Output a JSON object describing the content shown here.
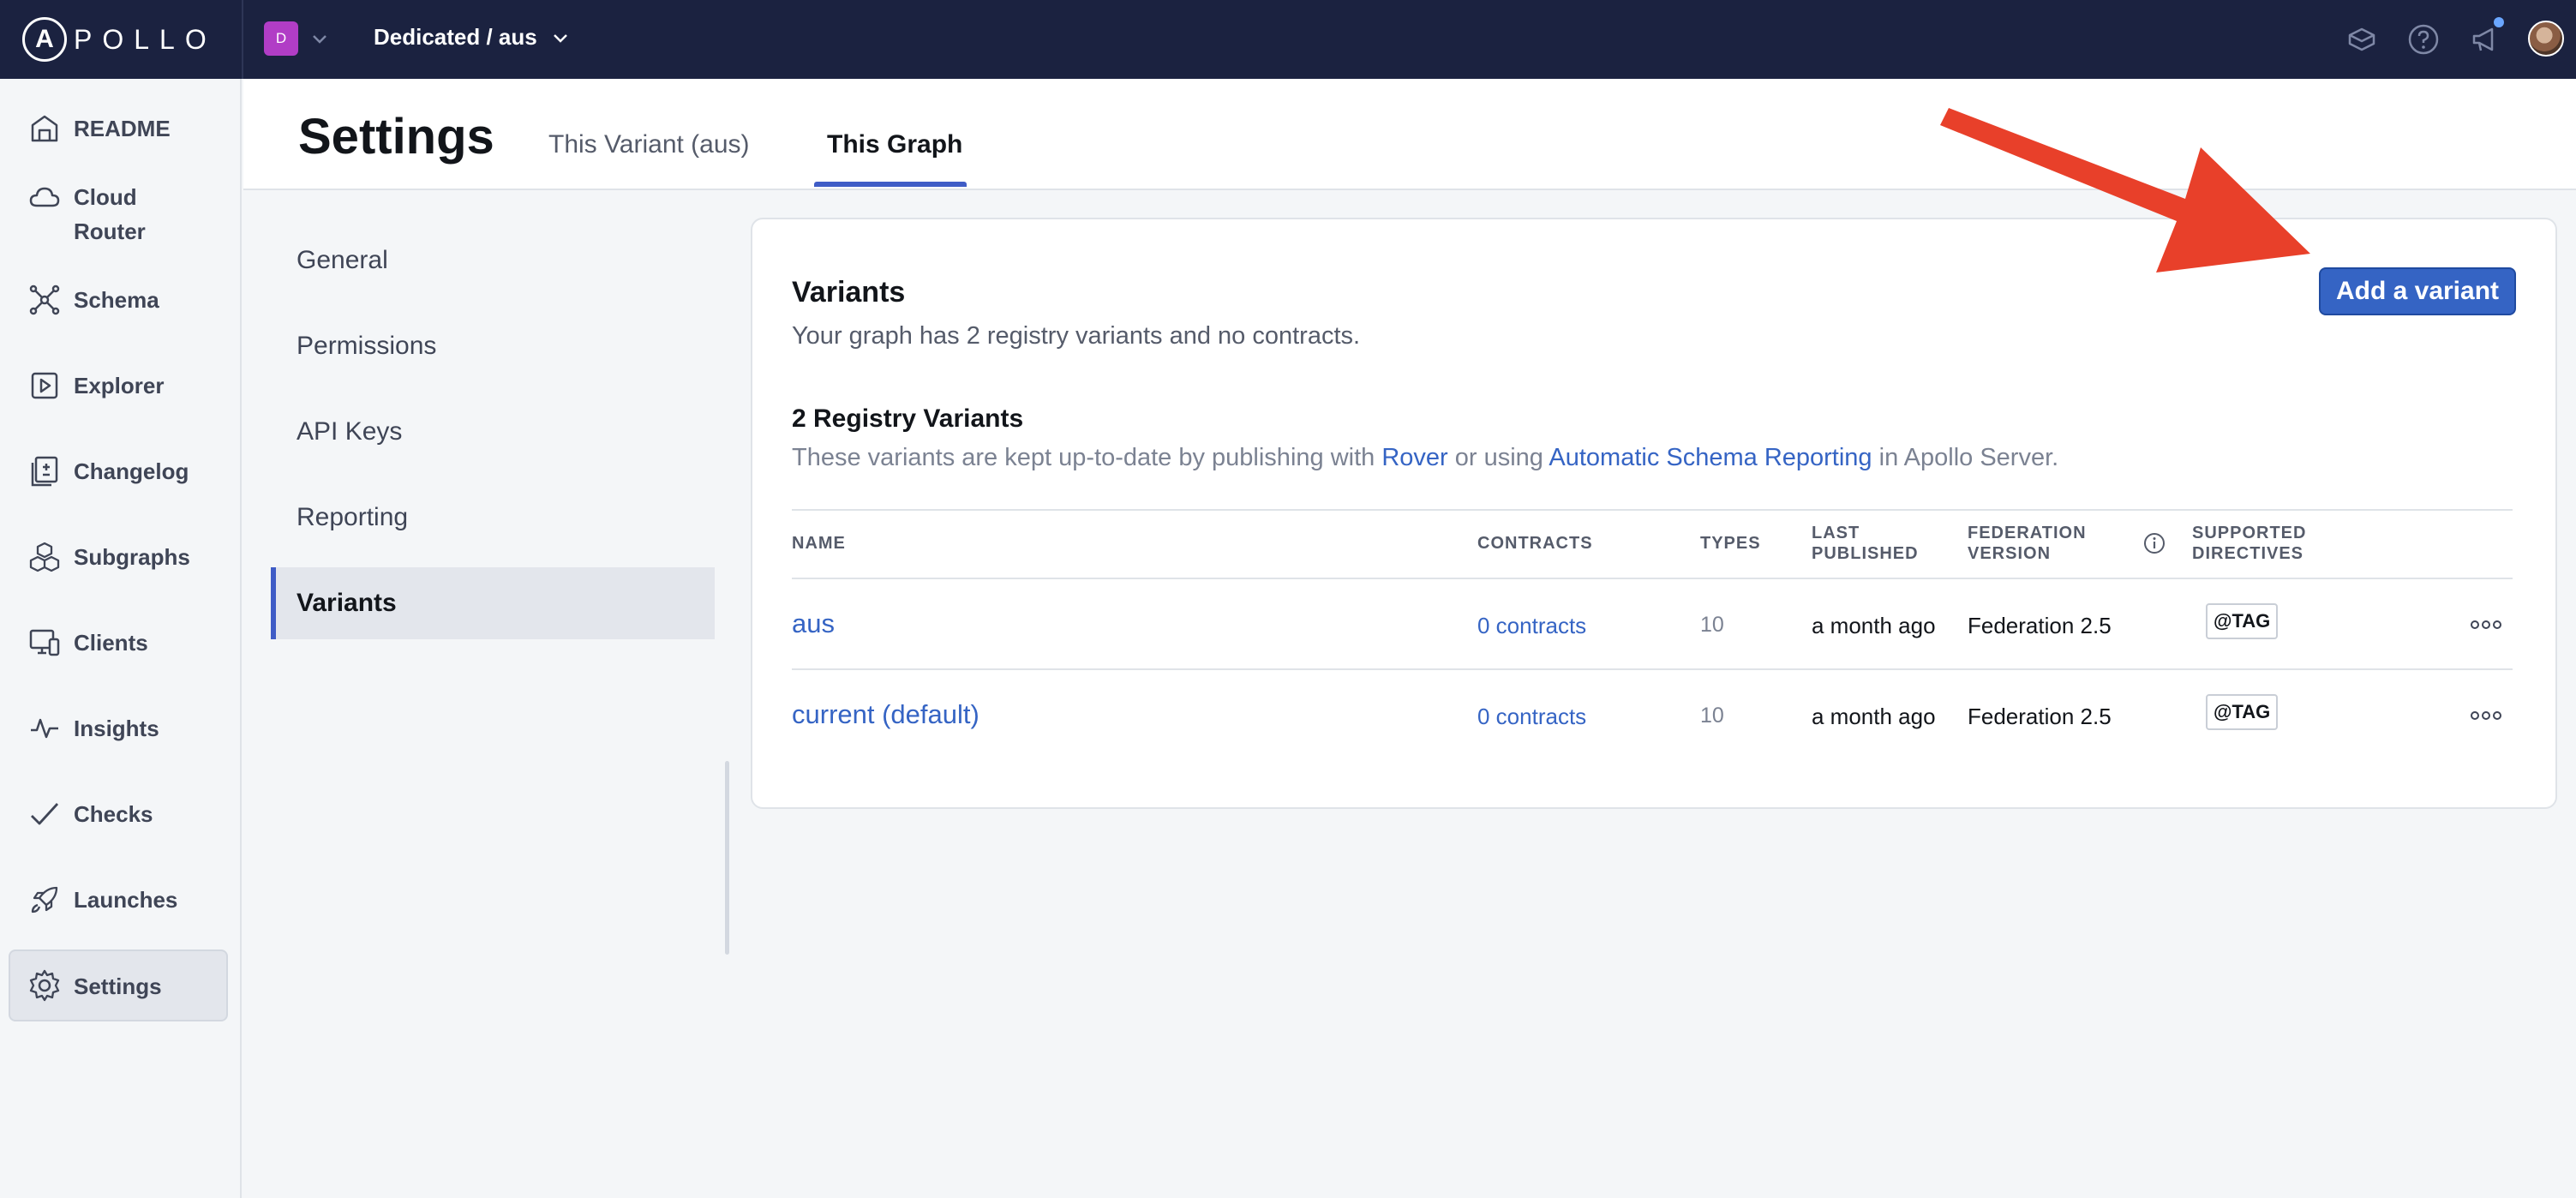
{
  "topbar": {
    "logo_letter": "A",
    "logo_text": "POLLO",
    "org_initial": "D",
    "graph_name": "Dedicated / aus",
    "icons": [
      "cube-icon",
      "help-icon",
      "megaphone-icon",
      "avatar"
    ]
  },
  "sidebar": {
    "items": [
      {
        "label": "README",
        "icon": "readme-icon"
      },
      {
        "label": "Cloud Router",
        "icon": "cloud-icon"
      },
      {
        "label": "Schema",
        "icon": "schema-icon"
      },
      {
        "label": "Explorer",
        "icon": "explorer-icon"
      },
      {
        "label": "Changelog",
        "icon": "changelog-icon"
      },
      {
        "label": "Subgraphs",
        "icon": "subgraphs-icon"
      },
      {
        "label": "Clients",
        "icon": "clients-icon"
      },
      {
        "label": "Insights",
        "icon": "insights-icon"
      },
      {
        "label": "Checks",
        "icon": "check-icon"
      },
      {
        "label": "Launches",
        "icon": "rocket-icon"
      },
      {
        "label": "Settings",
        "icon": "gear-icon",
        "active": true
      }
    ]
  },
  "header": {
    "title": "Settings",
    "tabs": [
      {
        "label": "This Variant (aus)"
      },
      {
        "label": "This Graph",
        "active": true
      }
    ]
  },
  "subnav": {
    "items": [
      {
        "label": "General"
      },
      {
        "label": "Permissions"
      },
      {
        "label": "API Keys"
      },
      {
        "label": "Reporting"
      },
      {
        "label": "Variants",
        "active": true
      }
    ]
  },
  "card": {
    "title": "Variants",
    "description": "Your graph has 2 registry variants and no contracts.",
    "add_button": "Add a variant",
    "section_title": "2 Registry Variants",
    "section_desc_1": "These variants are kept up-to-date by publishing with ",
    "section_link_1": "Rover",
    "section_desc_2": " or using ",
    "section_link_2": "Automatic Schema Reporting",
    "section_desc_3": " in Apollo Server.",
    "columns": {
      "name": "NAME",
      "contracts": "CONTRACTS",
      "types": "TYPES",
      "last_published_1": "LAST",
      "last_published_2": "PUBLISHED",
      "federation_1": "FEDERATION",
      "federation_2": "VERSION",
      "directives_1": "SUPPORTED",
      "directives_2": "DIRECTIVES"
    },
    "rows": [
      {
        "name": "aus",
        "contracts": "0 contracts",
        "types": "10",
        "last_published": "a month ago",
        "federation": "Federation 2.5",
        "directive": "@TAG"
      },
      {
        "name": "current (default)",
        "contracts": "0 contracts",
        "types": "10",
        "last_published": "a month ago",
        "federation": "Federation 2.5",
        "directive": "@TAG"
      }
    ]
  },
  "colors": {
    "topbar": "#1b2240",
    "accent": "#3564c4",
    "annotation_arrow": "#e8402a"
  }
}
